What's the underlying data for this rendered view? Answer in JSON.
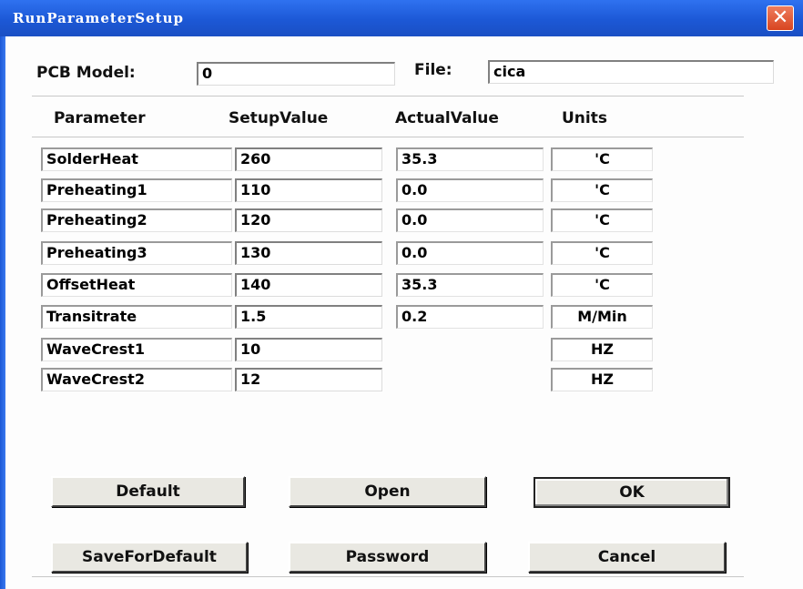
{
  "window": {
    "title": "RunParameterSetup",
    "close_glyph": "✕"
  },
  "header": {
    "pcb_model_label": "PCB Model:",
    "pcb_model_value": "0",
    "file_label": "File:",
    "file_value": "cica"
  },
  "columns": [
    "Parameter",
    "SetupValue",
    "ActualValue",
    "Units"
  ],
  "rows": [
    {
      "name": "SolderHeat",
      "setup": "260",
      "actual": "35.3",
      "unit": "'C"
    },
    {
      "name": "Preheating1",
      "setup": "110",
      "actual": "0.0",
      "unit": "'C"
    },
    {
      "name": "Preheating2",
      "setup": "120",
      "actual": "0.0",
      "unit": "'C"
    },
    {
      "name": "Preheating3",
      "setup": "130",
      "actual": "0.0",
      "unit": "'C"
    },
    {
      "name": "OffsetHeat",
      "setup": "140",
      "actual": "35.3",
      "unit": "'C"
    },
    {
      "name": "Transitrate",
      "setup": "1.5",
      "actual": "0.2",
      "unit": "M/Min"
    },
    {
      "name": "WaveCrest1",
      "setup": "10",
      "actual": "",
      "unit": "HZ"
    },
    {
      "name": "WaveCrest2",
      "setup": "12",
      "actual": "",
      "unit": "HZ"
    }
  ],
  "buttons": {
    "default": "Default",
    "open": "Open",
    "ok": "OK",
    "save_for_default": "SaveForDefault",
    "password": "Password",
    "cancel": "Cancel"
  },
  "colors": {
    "titlebar": "#1c58d6",
    "close": "#d84520"
  }
}
